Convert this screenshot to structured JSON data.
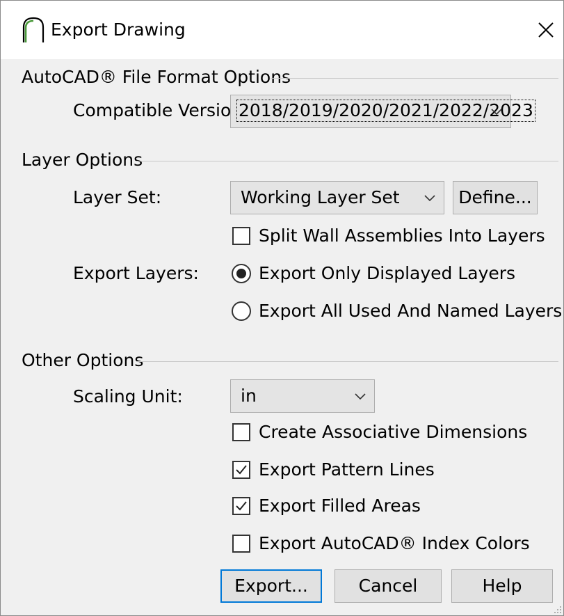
{
  "window": {
    "title": "Export Drawing",
    "app_icon": "arch-icon",
    "close_icon": "close-icon"
  },
  "autocad": {
    "group_label": "AutoCAD® File Format Options",
    "compatible_version_label": "Compatible Version:",
    "compatible_version_value": "2018/2019/2020/2021/2022/2023"
  },
  "layers": {
    "group_label": "Layer Options",
    "layer_set_label": "Layer Set:",
    "layer_set_value": "Working Layer Set",
    "define_button": "Define...",
    "split_wall_label": "Split Wall Assemblies Into Layers",
    "split_wall_checked": false,
    "export_layers_label": "Export Layers:",
    "radio_displayed_label": "Export Only Displayed Layers",
    "radio_all_label": "Export All Used And Named Layers",
    "selected_radio": "displayed"
  },
  "other": {
    "group_label": "Other Options",
    "scaling_unit_label": "Scaling Unit:",
    "scaling_unit_value": "in",
    "assoc_dims_label": "Create Associative Dimensions",
    "assoc_dims_checked": false,
    "pattern_lines_label": "Export Pattern Lines",
    "pattern_lines_checked": true,
    "filled_areas_label": "Export Filled Areas",
    "filled_areas_checked": true,
    "index_colors_label": "Export AutoCAD® Index Colors",
    "index_colors_checked": false
  },
  "buttons": {
    "export": "Export...",
    "cancel": "Cancel",
    "help": "Help"
  },
  "colors": {
    "accent": "#0078d7",
    "dialog_bg": "#f0f0f0",
    "titlebar_bg": "#ffffff",
    "control_bg": "#e1e1e1"
  }
}
